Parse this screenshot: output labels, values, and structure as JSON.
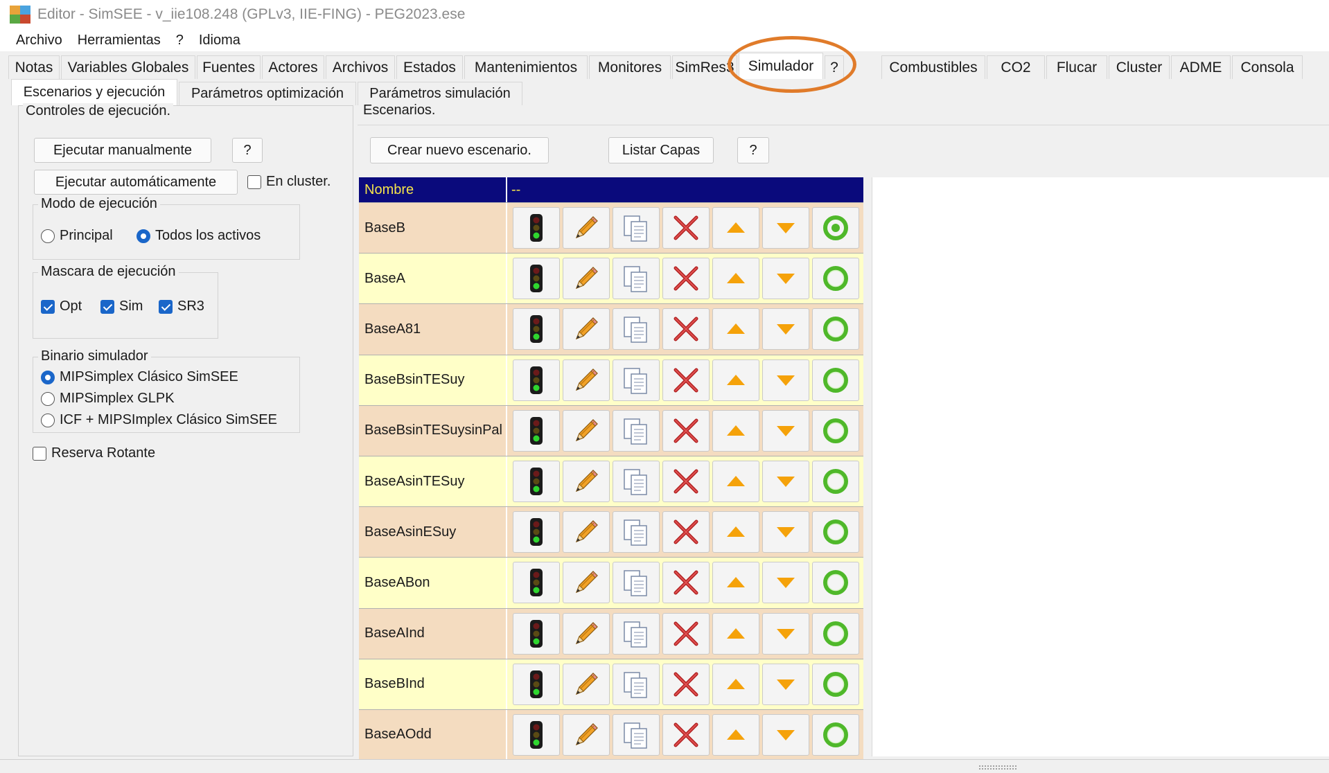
{
  "window": {
    "title": "Editor - SimSEE - v_iie108.248 (GPLv3, IIE-FING) - PEG2023.ese"
  },
  "menu": [
    "Archivo",
    "Herramientas",
    "?",
    "Idioma"
  ],
  "main_tabs": [
    "Notas",
    "Variables Globales",
    "Fuentes",
    "Actores",
    "Archivos",
    "Estados",
    "Mantenimientos",
    "Monitores",
    "SimRes3",
    "Simulador",
    "?",
    "Combustibles",
    "CO2",
    "Flucar",
    "Cluster",
    "ADME",
    "Consola"
  ],
  "active_main_tab": "Simulador",
  "sub_tabs": [
    "Escenarios y ejecución",
    "Parámetros optimización",
    "Parámetros simulación"
  ],
  "left": {
    "group_title": "Controles de ejecución.",
    "btn_manual": "Ejecutar manualmente",
    "btn_help": "?",
    "btn_auto": "Ejecutar automáticamente",
    "cluster_label": "En cluster.",
    "cluster_checked": false,
    "modo_title": "Modo de ejecución",
    "modo_options": [
      "Principal",
      "Todos los activos"
    ],
    "modo_selected": "Todos los activos",
    "mascara_title": "Mascara de ejecución",
    "mascara_options": [
      {
        "label": "Opt",
        "checked": true
      },
      {
        "label": "Sim",
        "checked": true
      },
      {
        "label": "SR3",
        "checked": true
      }
    ],
    "binario_title": "Binario simulador",
    "binario_options": [
      "MIPSimplex Clásico SimSEE",
      "MIPSimplex GLPK",
      "ICF + MIPSImplex Clásico SimSEE"
    ],
    "binario_selected": "MIPSimplex Clásico SimSEE",
    "reserva_label": "Reserva Rotante",
    "reserva_checked": false
  },
  "right": {
    "group_title": "Escenarios.",
    "btn_new": "Crear nuevo escenario.",
    "btn_layers": "Listar Capas",
    "btn_help": "?",
    "header_name": "Nombre",
    "header_rest": "--",
    "row_colors": {
      "odd": "#f4dcc0",
      "even": "#ffffc8",
      "header_bg": "#0a0a7c",
      "header_fg": "#f5e44b"
    },
    "scenarios": [
      "BaseB",
      "BaseA",
      "BaseA81",
      "BaseBsinTESuy",
      "BaseBsinTESuysinPal",
      "BaseAsinTESuy",
      "BaseAsinESuy",
      "BaseABon",
      "BaseAInd",
      "BaseBInd",
      "BaseAOdd"
    ],
    "active_scenario": "BaseB",
    "row_actions": [
      "traffic-light-icon",
      "pencil-icon",
      "copy-icon",
      "delete-icon",
      "move-up-icon",
      "move-down-icon",
      "active-ring-icon"
    ]
  }
}
